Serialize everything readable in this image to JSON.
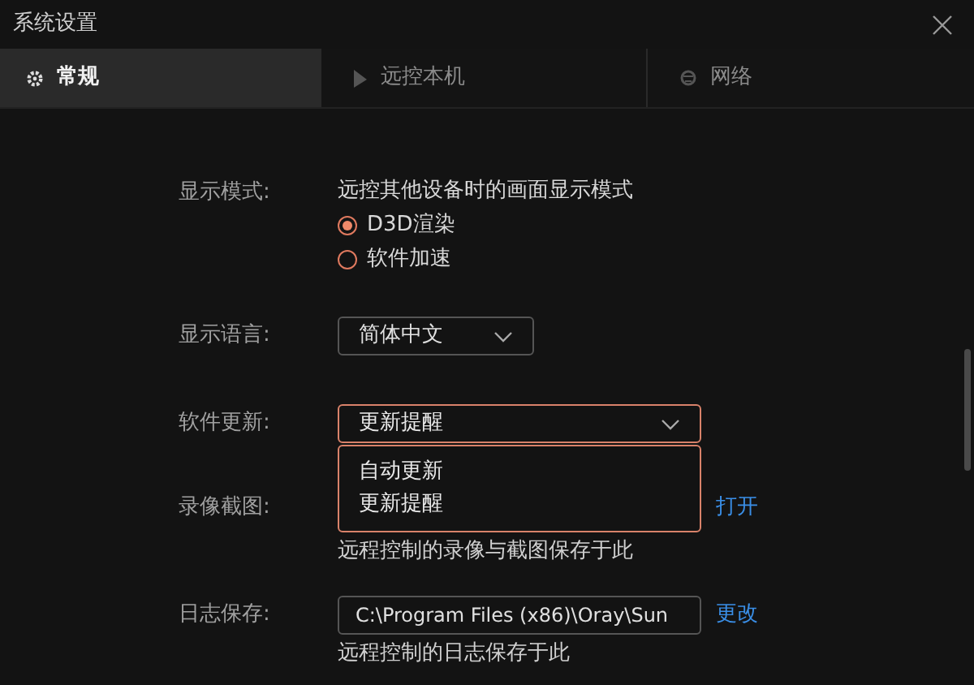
{
  "window": {
    "title": "系统设置"
  },
  "tabs": [
    {
      "label": "常规",
      "kind": "gear",
      "selected": true
    },
    {
      "label": "远控本机",
      "kind": "play",
      "selected": false
    },
    {
      "label": "网络",
      "kind": "globe",
      "selected": false
    }
  ],
  "display_mode": {
    "label": "显示模式:",
    "description": "远控其他设备时的画面显示模式",
    "options": [
      {
        "label": "D3D渲染",
        "selected": true
      },
      {
        "label": "软件加速",
        "selected": false
      }
    ]
  },
  "language": {
    "label": "显示语言:",
    "value": "简体中文"
  },
  "update": {
    "label": "软件更新:",
    "value": "更新提醒",
    "expanded": true,
    "options": [
      "自动更新",
      "更新提醒"
    ]
  },
  "recording": {
    "label": "录像截图:",
    "link": "打开",
    "caption": "远程控制的录像与截图保存于此"
  },
  "log": {
    "label": "日志保存:",
    "value": "C:\\Program Files (x86)\\Oray\\Sun",
    "link": "更改",
    "caption": "远程控制的日志保存于此"
  }
}
